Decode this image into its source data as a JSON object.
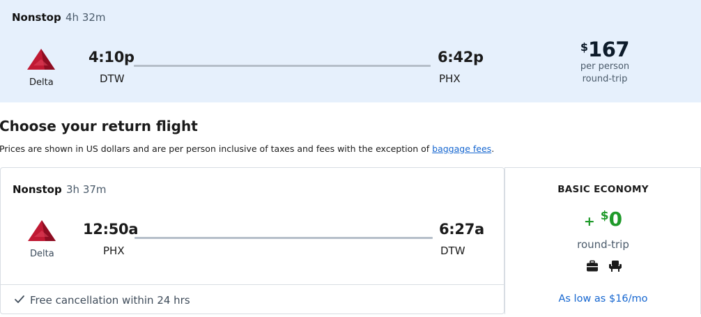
{
  "outbound": {
    "stops": "Nonstop",
    "duration": "4h 32m",
    "airline": "Delta",
    "depart_time": "4:10p",
    "depart_code": "DTW",
    "arrive_time": "6:42p",
    "arrive_code": "PHX",
    "price_symbol": "$",
    "price_value": "167",
    "price_line1": "per person",
    "price_line2": "round-trip"
  },
  "section": {
    "title": "Choose your return flight",
    "disclaimer_text": "Prices are shown in US dollars and are per person inclusive of taxes and fees with the exception of ",
    "disclaimer_link": "baggage fees",
    "disclaimer_end": "."
  },
  "return_flight": {
    "stops": "Nonstop",
    "duration": "3h 37m",
    "airline": "Delta",
    "depart_time": "12:50a",
    "depart_code": "PHX",
    "arrive_time": "6:27a",
    "arrive_code": "DTW",
    "free_cancel": "Free cancellation within 24 hrs",
    "fare": {
      "name": "BASIC ECONOMY",
      "plus": "+",
      "price_symbol": "$",
      "price_value": "0",
      "price_sub": "round-trip",
      "financing": "As low as $16/mo"
    }
  },
  "colors": {
    "selected_bg": "#e6f0fc",
    "delta_red": "#c01933",
    "price_green": "#1f9a2a",
    "link_blue": "#1566d0"
  },
  "icons": [
    "delta-logo-icon",
    "carry-on-bag-icon",
    "seat-icon",
    "checkmark-icon"
  ]
}
